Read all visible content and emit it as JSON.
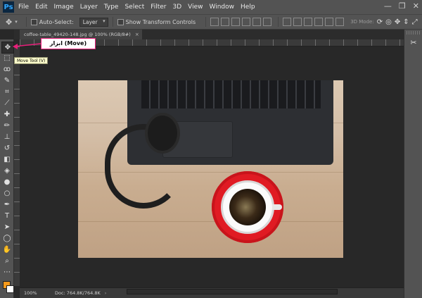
{
  "app": {
    "logo": "Ps"
  },
  "menu": [
    "File",
    "Edit",
    "Image",
    "Layer",
    "Type",
    "Select",
    "Filter",
    "3D",
    "View",
    "Window",
    "Help"
  ],
  "window_controls": {
    "minimize": "—",
    "maximize": "❐",
    "close": "✕"
  },
  "options": {
    "auto_select_label": "Auto-Select:",
    "auto_select_value": "Layer",
    "show_transform_label": "Show Transform Controls",
    "mode_3d_label": "3D Mode:"
  },
  "document": {
    "tab_title": "coffee-table_49420-148.jpg @ 100% (RGB/8#)",
    "tab_close": "×"
  },
  "tooltip": {
    "text": "Move Tool (V)"
  },
  "callout": {
    "text": "ابزار (Move)",
    "border_color": "#e91e7a"
  },
  "status": {
    "zoom": "100%",
    "doc_size": "Doc: 764.8K/764.8K",
    "arrow": "›"
  },
  "colors": {
    "foreground": "#f59a1c",
    "background": "#ffffff",
    "accent": "#31a8ff"
  },
  "tools": [
    {
      "name": "move-tool",
      "glyph": "✥"
    },
    {
      "name": "marquee-tool",
      "glyph": "⬚"
    },
    {
      "name": "lasso-tool",
      "glyph": "ꝏ"
    },
    {
      "name": "quick-select-tool",
      "glyph": "✎"
    },
    {
      "name": "crop-tool",
      "glyph": "⌗"
    },
    {
      "name": "eyedropper-tool",
      "glyph": "⟋"
    },
    {
      "name": "healing-tool",
      "glyph": "✚"
    },
    {
      "name": "brush-tool",
      "glyph": "✏"
    },
    {
      "name": "stamp-tool",
      "glyph": "⊥"
    },
    {
      "name": "history-brush-tool",
      "glyph": "↺"
    },
    {
      "name": "eraser-tool",
      "glyph": "◧"
    },
    {
      "name": "paint-bucket-tool",
      "glyph": "◈"
    },
    {
      "name": "blur-tool",
      "glyph": "●"
    },
    {
      "name": "dodge-tool",
      "glyph": "○"
    },
    {
      "name": "pen-tool",
      "glyph": "✒"
    },
    {
      "name": "type-tool",
      "glyph": "T"
    },
    {
      "name": "path-select-tool",
      "glyph": "➤"
    },
    {
      "name": "shape-tool",
      "glyph": "◯"
    },
    {
      "name": "hand-tool",
      "glyph": "✋"
    },
    {
      "name": "zoom-tool",
      "glyph": "⌕"
    },
    {
      "name": "more-tools",
      "glyph": "⋯"
    }
  ]
}
